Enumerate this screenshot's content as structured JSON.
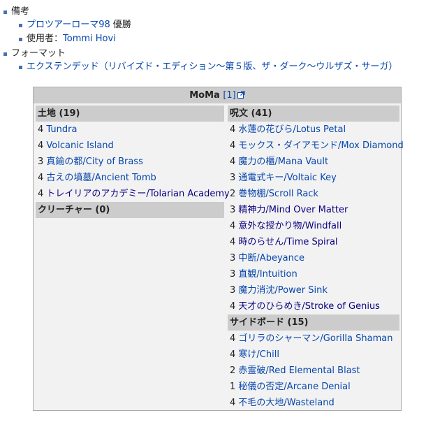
{
  "notes": {
    "label": "備考",
    "items": [
      {
        "link": "プロツアーローマ98",
        "suffix": " 優勝"
      },
      {
        "prefix": "使用者：",
        "link": "Tommi Hovi"
      }
    ]
  },
  "format": {
    "label": "フォーマット",
    "item_link": "エクステンデッド",
    "item_suffix": "（リバイズド・エディション～第５版、ザ・ダーク～ウルザズ・サーガ）"
  },
  "deck": {
    "title": "MoMa",
    "ref": "[1]",
    "lands": {
      "header": "土地 (19)",
      "cards": [
        {
          "qty": "4",
          "name": "Tundra"
        },
        {
          "qty": "4",
          "name": "Volcanic Island"
        },
        {
          "qty": "3",
          "name": "真鍮の都/City of Brass"
        },
        {
          "qty": "4",
          "name": "古えの墳墓/Ancient Tomb"
        },
        {
          "qty": "4",
          "name": "トレイリアのアカデミー/Tolarian Academy"
        }
      ]
    },
    "creatures": {
      "header": "クリーチャー (0)"
    },
    "spells": {
      "header": "呪文 (41)",
      "cards": [
        {
          "qty": "4",
          "name": "水蓮の花びら/Lotus Petal"
        },
        {
          "qty": "4",
          "name": "モックス・ダイアモンド/Mox Diamond"
        },
        {
          "qty": "4",
          "name": "魔力の櫃/Mana Vault"
        },
        {
          "qty": "3",
          "name": "通電式キー/Voltaic Key"
        },
        {
          "qty": "2",
          "name": "巻物棚/Scroll Rack"
        },
        {
          "qty": "3",
          "name": "精神力/Mind Over Matter"
        },
        {
          "qty": "4",
          "name": "意外な授かり物/Windfall"
        },
        {
          "qty": "4",
          "name": "時のらせん/Time Spiral"
        },
        {
          "qty": "3",
          "name": "中断/Abeyance"
        },
        {
          "qty": "3",
          "name": "直観/Intuition"
        },
        {
          "qty": "3",
          "name": "魔力消沈/Power Sink"
        },
        {
          "qty": "4",
          "name": "天才のひらめき/Stroke of Genius"
        }
      ]
    },
    "sideboard": {
      "header": "サイドボード (15)",
      "cards": [
        {
          "qty": "4",
          "name": "ゴリラのシャーマン/Gorilla Shaman"
        },
        {
          "qty": "4",
          "name": "寒け/Chill"
        },
        {
          "qty": "2",
          "name": "赤霊破/Red Elemental Blast"
        },
        {
          "qty": "1",
          "name": "秘儀の否定/Arcane Denial"
        },
        {
          "qty": "4",
          "name": "不毛の大地/Wasteland"
        }
      ]
    }
  },
  "colors": {
    "link": "#0645ad",
    "visited": "#0b0080",
    "header_bg": "#cccccc",
    "box_bg": "#f2f2f2"
  }
}
